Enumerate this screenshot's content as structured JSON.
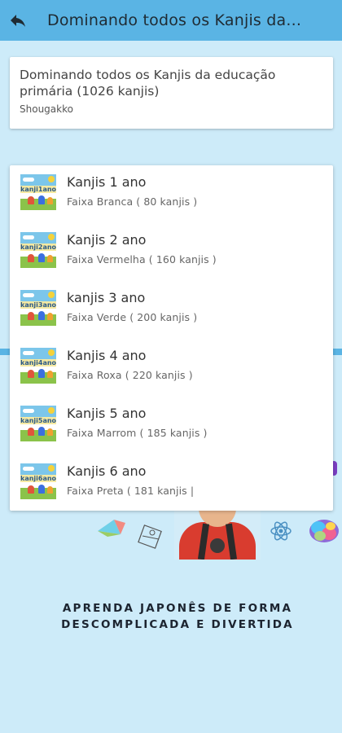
{
  "appbar": {
    "back_icon": "back-arrow-icon",
    "title": "Dominando todos os Kanjis da..."
  },
  "header_card": {
    "title": "Dominando todos os Kanjis da educação primária (1026 kanjis)",
    "subtitle": "Shougakko"
  },
  "list": [
    {
      "title": "Kanjis 1 ano",
      "subtitle": "Faixa Branca ( 80 kanjis )",
      "thumb_label": "kanji1ano"
    },
    {
      "title": "Kanjis 2 ano",
      "subtitle": "Faixa Vermelha ( 160 kanjis )",
      "thumb_label": "kanji2ano"
    },
    {
      "title": "kanjis 3 ano",
      "subtitle": "Faixa Verde ( 200 kanjis )",
      "thumb_label": "kanji3ano"
    },
    {
      "title": "Kanjis 4 ano",
      "subtitle": "Faixa Roxa ( 220 kanjis )",
      "thumb_label": "kanji4ano"
    },
    {
      "title": "Kanjis 5 ano",
      "subtitle": "Faixa Marrom ( 185 kanjis )",
      "thumb_label": "kanji5ano"
    },
    {
      "title": "Kanjis 6 ano",
      "subtitle": "Faixa Preta ( 181 kanjis |",
      "thumb_label": "kanji6ano"
    }
  ],
  "tagline": {
    "line1": "APRENDA JAPONÊS DE FORMA",
    "line2": "DESCOMPLICADA E DIVERTIDA"
  },
  "colors": {
    "appbar": "#5ab4e4",
    "background": "#cdebf9",
    "card": "#ffffff"
  }
}
